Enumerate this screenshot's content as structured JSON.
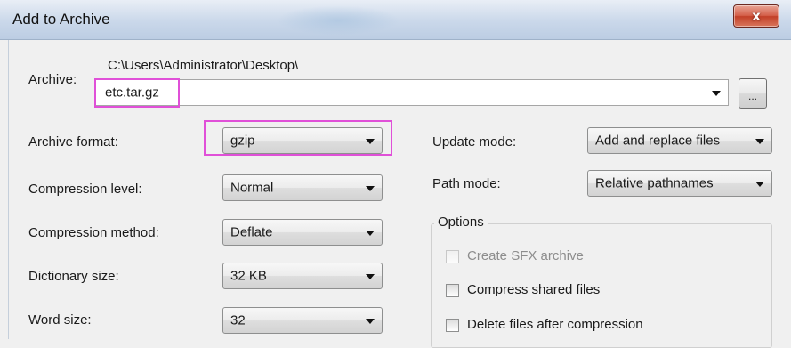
{
  "window": {
    "title": "Add to Archive",
    "close_glyph": "x"
  },
  "archive": {
    "label": "Archive:",
    "path": "C:\\Users\\Administrator\\Desktop\\",
    "filename": "etc.tar.gz",
    "browse_label": "..."
  },
  "left_fields": {
    "archive_format_label": "Archive format:",
    "archive_format_value": "gzip",
    "compression_level_label": "Compression level:",
    "compression_level_value": "Normal",
    "compression_method_label": "Compression method:",
    "compression_method_value": "Deflate",
    "dictionary_size_label": "Dictionary size:",
    "dictionary_size_value": "32 KB",
    "word_size_label": "Word size:",
    "word_size_value": "32"
  },
  "right_fields": {
    "update_mode_label": "Update mode:",
    "update_mode_value": "Add and replace files",
    "path_mode_label": "Path mode:",
    "path_mode_value": "Relative pathnames"
  },
  "options": {
    "title": "Options",
    "create_sfx": {
      "label": "Create SFX archive",
      "checked": false,
      "enabled": false
    },
    "compress_shared": {
      "label": "Compress shared files",
      "checked": false,
      "enabled": true
    },
    "delete_after": {
      "label": "Delete files after compression",
      "checked": false,
      "enabled": true
    }
  },
  "highlight_color": "#e050d8",
  "icons": [
    "close-icon",
    "dropdown-arrow-icon",
    "checkbox-icon"
  ]
}
